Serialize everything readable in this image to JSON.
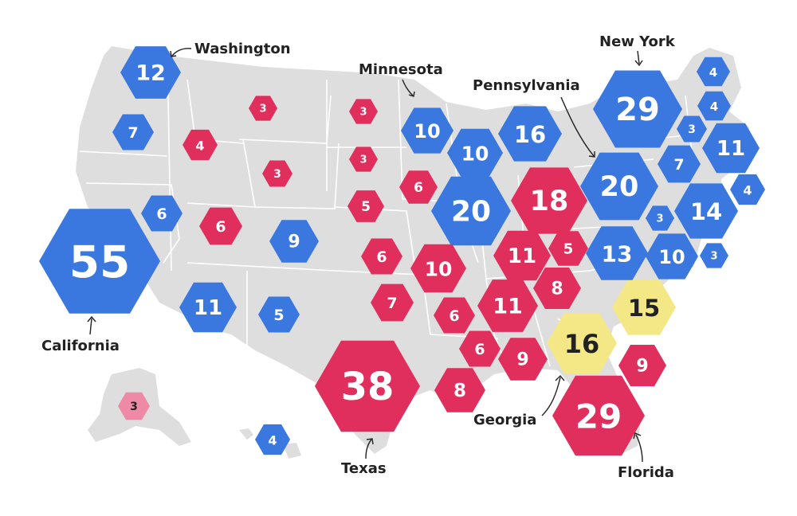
{
  "colors": {
    "blue": "#3a78e0",
    "red": "#e02f5c",
    "yellow": "#f4e886",
    "pink": "#ef8aa6",
    "land": "#dedede",
    "text_light": "#ffffff",
    "text_dark": "#222222"
  },
  "hexes": [
    {
      "id": "wa",
      "votes": "12",
      "color": "blue"
    },
    {
      "id": "or",
      "votes": "7",
      "color": "blue"
    },
    {
      "id": "ca",
      "votes": "55",
      "color": "blue"
    },
    {
      "id": "nv",
      "votes": "6",
      "color": "blue"
    },
    {
      "id": "id",
      "votes": "4",
      "color": "red"
    },
    {
      "id": "mt",
      "votes": "3",
      "color": "red"
    },
    {
      "id": "wy",
      "votes": "3",
      "color": "red"
    },
    {
      "id": "ut",
      "votes": "6",
      "color": "red"
    },
    {
      "id": "co",
      "votes": "9",
      "color": "blue"
    },
    {
      "id": "az",
      "votes": "11",
      "color": "blue"
    },
    {
      "id": "nm",
      "votes": "5",
      "color": "blue"
    },
    {
      "id": "nd",
      "votes": "3",
      "color": "red"
    },
    {
      "id": "sd",
      "votes": "3",
      "color": "red"
    },
    {
      "id": "ne",
      "votes": "5",
      "color": "red"
    },
    {
      "id": "ks",
      "votes": "6",
      "color": "red"
    },
    {
      "id": "ok",
      "votes": "7",
      "color": "red"
    },
    {
      "id": "tx",
      "votes": "38",
      "color": "red"
    },
    {
      "id": "mn",
      "votes": "10",
      "color": "blue"
    },
    {
      "id": "wi",
      "votes": "10",
      "color": "blue"
    },
    {
      "id": "ia",
      "votes": "6",
      "color": "red"
    },
    {
      "id": "il",
      "votes": "20",
      "color": "blue"
    },
    {
      "id": "mo",
      "votes": "10",
      "color": "red"
    },
    {
      "id": "ar",
      "votes": "6",
      "color": "red"
    },
    {
      "id": "la",
      "votes": "8",
      "color": "red"
    },
    {
      "id": "mi",
      "votes": "16",
      "color": "blue"
    },
    {
      "id": "in",
      "votes": "11",
      "color": "red"
    },
    {
      "id": "oh",
      "votes": "18",
      "color": "red"
    },
    {
      "id": "ky",
      "votes": "8",
      "color": "red"
    },
    {
      "id": "tn",
      "votes": "11",
      "color": "red"
    },
    {
      "id": "ms",
      "votes": "6",
      "color": "red"
    },
    {
      "id": "al",
      "votes": "9",
      "color": "red"
    },
    {
      "id": "wv",
      "votes": "5",
      "color": "red"
    },
    {
      "id": "ga",
      "votes": "16",
      "color": "yellow"
    },
    {
      "id": "fl",
      "votes": "29",
      "color": "red"
    },
    {
      "id": "sc",
      "votes": "9",
      "color": "red"
    },
    {
      "id": "nc",
      "votes": "15",
      "color": "yellow"
    },
    {
      "id": "va",
      "votes": "13",
      "color": "blue"
    },
    {
      "id": "md",
      "votes": "10",
      "color": "blue"
    },
    {
      "id": "de",
      "votes": "3",
      "color": "blue"
    },
    {
      "id": "nj",
      "votes": "14",
      "color": "blue"
    },
    {
      "id": "dc",
      "votes": "3",
      "color": "blue"
    },
    {
      "id": "pa",
      "votes": "20",
      "color": "blue"
    },
    {
      "id": "ny",
      "votes": "29",
      "color": "blue"
    },
    {
      "id": "ct",
      "votes": "7",
      "color": "blue"
    },
    {
      "id": "ri",
      "votes": "4",
      "color": "blue"
    },
    {
      "id": "ma",
      "votes": "11",
      "color": "blue"
    },
    {
      "id": "vt",
      "votes": "3",
      "color": "blue"
    },
    {
      "id": "nh",
      "votes": "4",
      "color": "blue"
    },
    {
      "id": "me",
      "votes": "4",
      "color": "blue"
    },
    {
      "id": "ak",
      "votes": "3",
      "color": "pink"
    },
    {
      "id": "hi",
      "votes": "4",
      "color": "blue"
    }
  ],
  "labels": {
    "washington": "Washington",
    "minnesota": "Minnesota",
    "new_york": "New York",
    "pennsylvania": "Pennsylvania",
    "california": "California",
    "texas": "Texas",
    "georgia": "Georgia",
    "florida": "Florida"
  }
}
